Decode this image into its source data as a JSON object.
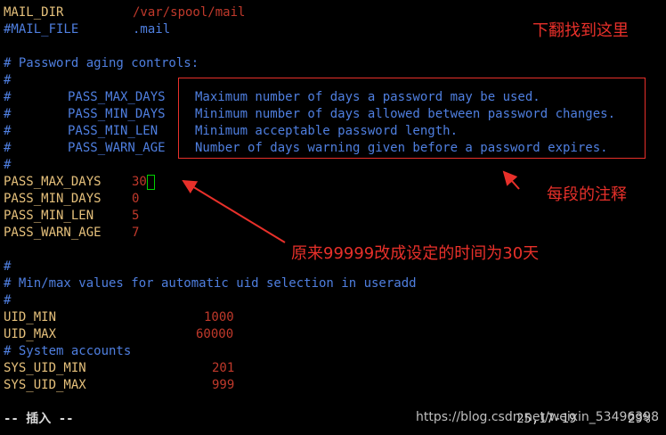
{
  "editor": {
    "mail_dir_key": "MAIL_DIR",
    "mail_dir_val": "/var/spool/mail",
    "mail_file_line": "#MAIL_FILE",
    "mail_file_val": ".mail",
    "aging_header": "# Password aging controls:",
    "hash": "#",
    "comments": [
      {
        "name": "PASS_MAX_DAYS",
        "desc": "Maximum number of days a password may be used."
      },
      {
        "name": "PASS_MIN_DAYS",
        "desc": "Minimum number of days allowed between password changes."
      },
      {
        "name": "PASS_MIN_LEN",
        "desc": "Minimum acceptable password length."
      },
      {
        "name": "PASS_WARN_AGE",
        "desc": "Number of days warning given before a password expires."
      }
    ],
    "settings": [
      {
        "key": "PASS_MAX_DAYS",
        "value": "30"
      },
      {
        "key": "PASS_MIN_DAYS",
        "value": "0"
      },
      {
        "key": "PASS_MIN_LEN",
        "value": "5"
      },
      {
        "key": "PASS_WARN_AGE",
        "value": "7"
      }
    ],
    "uid_header": "# Min/max values for automatic uid selection in useradd",
    "uid_min_key": "UID_MIN",
    "uid_min_val": "1000",
    "uid_max_key": "UID_MAX",
    "uid_max_val": "60000",
    "sys_header": "# System accounts",
    "sys_uid_min_key": "SYS_UID_MIN",
    "sys_uid_min_val": "201",
    "sys_uid_max_key": "SYS_UID_MAX",
    "sys_uid_max_val": "999"
  },
  "status": {
    "mode": "-- 插入 --",
    "position": "25,17-19",
    "percent": "29%"
  },
  "annotations": {
    "scroll_note": "下翻找到这里",
    "comment_note": "每段的注释",
    "change_note": "原来99999改成设定的时间为30天"
  },
  "watermark": "https://blog.csdn.net/weixin_53496398",
  "colors": {
    "background": "#000000",
    "key": "#e5c07b",
    "value": "#c0392b",
    "comment": "#4f7fe0",
    "annotation": "#e8302a"
  }
}
